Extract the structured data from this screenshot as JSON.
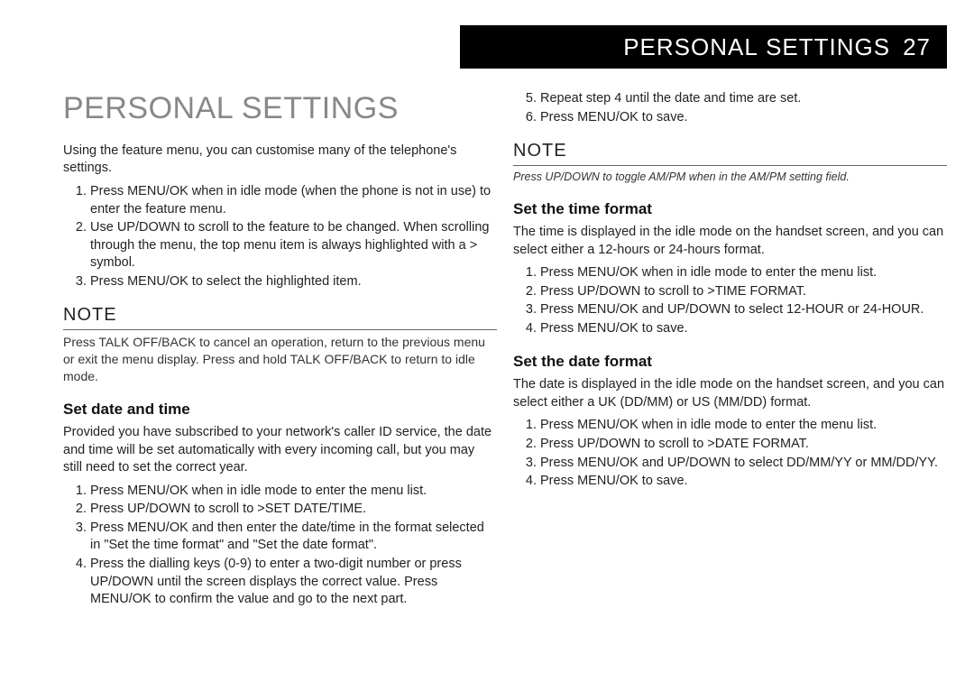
{
  "header": {
    "title_light": "PERSONAL",
    "title_bold": "SETTINGS",
    "page_number": "27"
  },
  "left": {
    "title": "PERSONAL SETTINGS",
    "intro": "Using the feature menu, you can customise many of the telephone's settings.",
    "intro_steps": [
      "Press MENU/OK when in idle mode (when the phone is not in use) to enter the feature menu.",
      "Use UP/DOWN to scroll to the feature to be changed. When scrolling through the menu, the top menu item is always highlighted with a > symbol.",
      "Press MENU/OK to select the highlighted item."
    ],
    "note_head": "NOTE",
    "note_body": "Press TALK OFF/BACK to cancel an operation, return to the previous menu or exit the menu display. Press and hold TALK OFF/BACK to return to idle mode.",
    "sec1_head": "Set date and time",
    "sec1_para": "Provided you have subscribed to your network's caller ID service, the date and time will be set automatically with every incoming call, but you may still need to set the correct year.",
    "sec1_steps": [
      "Press MENU/OK when in idle mode to enter the menu list.",
      "Press UP/DOWN to scroll to >SET DATE/TIME.",
      "Press MENU/OK and then enter the date/time in the format selected in \"Set the time format\" and \"Set the date format\".",
      "Press the dialling keys (0-9) to enter a two-digit number or press UP/DOWN until the screen displays the correct value. Press MENU/OK to confirm the value and go to the next part."
    ]
  },
  "right": {
    "cont_steps": [
      "Repeat step 4 until the date and time are set.",
      "Press MENU/OK to save."
    ],
    "note_head": "NOTE",
    "note_body": "Press UP/DOWN to toggle AM/PM when in the AM/PM setting field.",
    "sec2_head": "Set the time format",
    "sec2_para": "The time is displayed in the idle mode on the handset screen, and you can select either a 12-hours or 24-hours format.",
    "sec2_steps": [
      "Press MENU/OK when in idle mode to enter the menu list.",
      "Press UP/DOWN to scroll to >TIME FORMAT.",
      "Press MENU/OK and UP/DOWN to select 12-HOUR or 24-HOUR.",
      "Press MENU/OK to save."
    ],
    "sec3_head": "Set the date format",
    "sec3_para": "The date is displayed in the idle mode on the handset screen, and you can select either a UK (DD/MM) or US (MM/DD) format.",
    "sec3_steps": [
      "Press MENU/OK when in idle mode to enter the menu list.",
      "Press UP/DOWN to scroll to >DATE FORMAT.",
      "Press MENU/OK and UP/DOWN to select DD/MM/YY or MM/DD/YY.",
      "Press MENU/OK to save."
    ]
  }
}
